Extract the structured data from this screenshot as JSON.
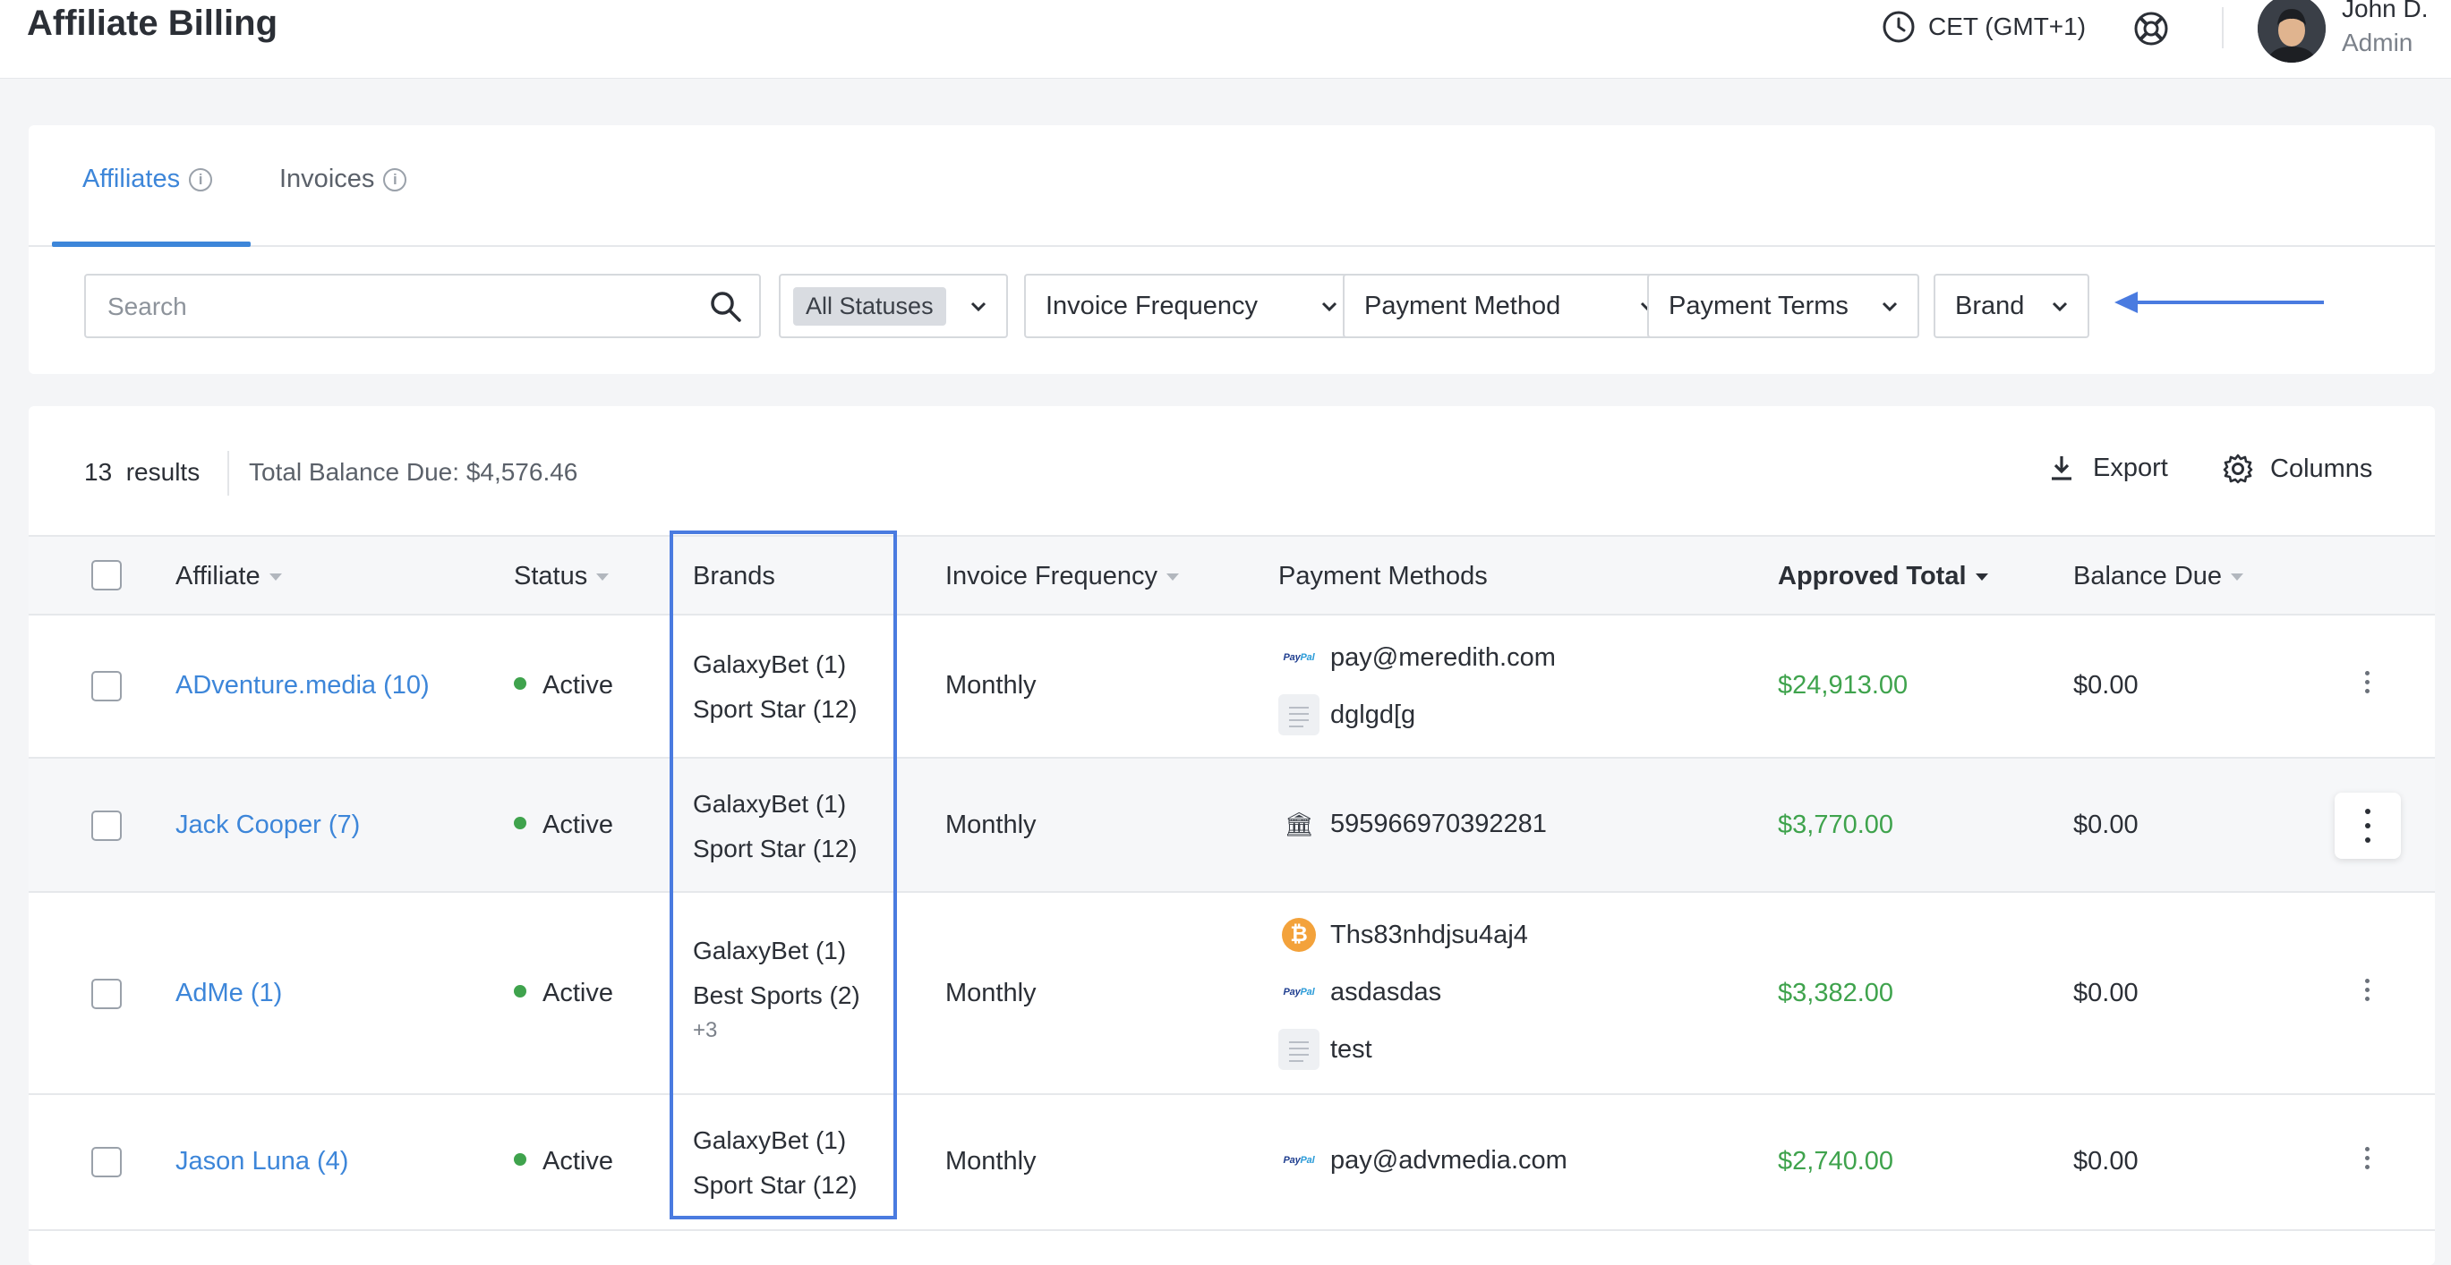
{
  "header": {
    "app_title": "Affiliate Billing",
    "timezone": "CET (GMT+1)",
    "user_name": "John D.",
    "user_role": "Admin"
  },
  "tabs": [
    {
      "label": "Affiliates",
      "active": true
    },
    {
      "label": "Invoices",
      "active": false
    }
  ],
  "filters": {
    "search_placeholder": "Search",
    "status_chip": "All Statuses",
    "invoice_frequency": "Invoice Frequency",
    "payment_method": "Payment Method",
    "payment_terms": "Payment Terms",
    "brand": "Brand"
  },
  "summary": {
    "results_count": "13",
    "results_label": "results",
    "total_balance_due": "Total Balance Due: $4,576.46"
  },
  "actions": {
    "export_label": "Export",
    "columns_label": "Columns"
  },
  "columns": {
    "affiliate": "Affiliate",
    "status": "Status",
    "brands": "Brands",
    "invoice_frequency": "Invoice Frequency",
    "payment_methods": "Payment Methods",
    "approved_total": "Approved Total",
    "balance_due": "Balance Due"
  },
  "rows": [
    {
      "affiliate": "ADventure.media (10)",
      "status": "Active",
      "brands": [
        "GalaxyBet (1)",
        "Sport Star (12)"
      ],
      "brands_more": "",
      "invoice_frequency": "Monthly",
      "payment_methods": [
        {
          "icon": "paypal-icon",
          "value": "pay@meredith.com"
        },
        {
          "icon": "document-icon",
          "value": "dglgd[g"
        }
      ],
      "approved_total": "$24,913.00",
      "balance_due": "$0.00"
    },
    {
      "affiliate": "Jack Cooper (7)",
      "status": "Active",
      "brands": [
        "GalaxyBet (1)",
        "Sport Star (12)"
      ],
      "brands_more": "",
      "invoice_frequency": "Monthly",
      "payment_methods": [
        {
          "icon": "bank-icon",
          "value": "595966970392281"
        }
      ],
      "approved_total": "$3,770.00",
      "balance_due": "$0.00"
    },
    {
      "affiliate": "AdMe (1)",
      "status": "Active",
      "brands": [
        "GalaxyBet (1)",
        "Best Sports (2)"
      ],
      "brands_more": "+3",
      "invoice_frequency": "Monthly",
      "payment_methods": [
        {
          "icon": "bitcoin-icon",
          "value": "Ths83nhdjsu4aj4"
        },
        {
          "icon": "paypal-icon",
          "value": "asdasdas"
        },
        {
          "icon": "document-icon",
          "value": "test"
        }
      ],
      "approved_total": "$3,382.00",
      "balance_due": "$0.00"
    },
    {
      "affiliate": "Jason Luna (4)",
      "status": "Active",
      "brands": [
        "GalaxyBet (1)",
        "Sport Star (12)"
      ],
      "brands_more": "",
      "invoice_frequency": "Monthly",
      "payment_methods": [
        {
          "icon": "paypal-icon",
          "value": "pay@advmedia.com"
        }
      ],
      "approved_total": "$2,740.00",
      "balance_due": "$0.00"
    }
  ],
  "paypal_wordmark": {
    "part1": "Pay",
    "part2": "Pal"
  },
  "bitcoin_glyph": "₿",
  "bank_glyph": "🏛",
  "info_glyph": "i",
  "colors": {
    "accent": "#3d86d9",
    "approved_green": "#3fa34d",
    "highlight_blue": "#4a7be0"
  }
}
